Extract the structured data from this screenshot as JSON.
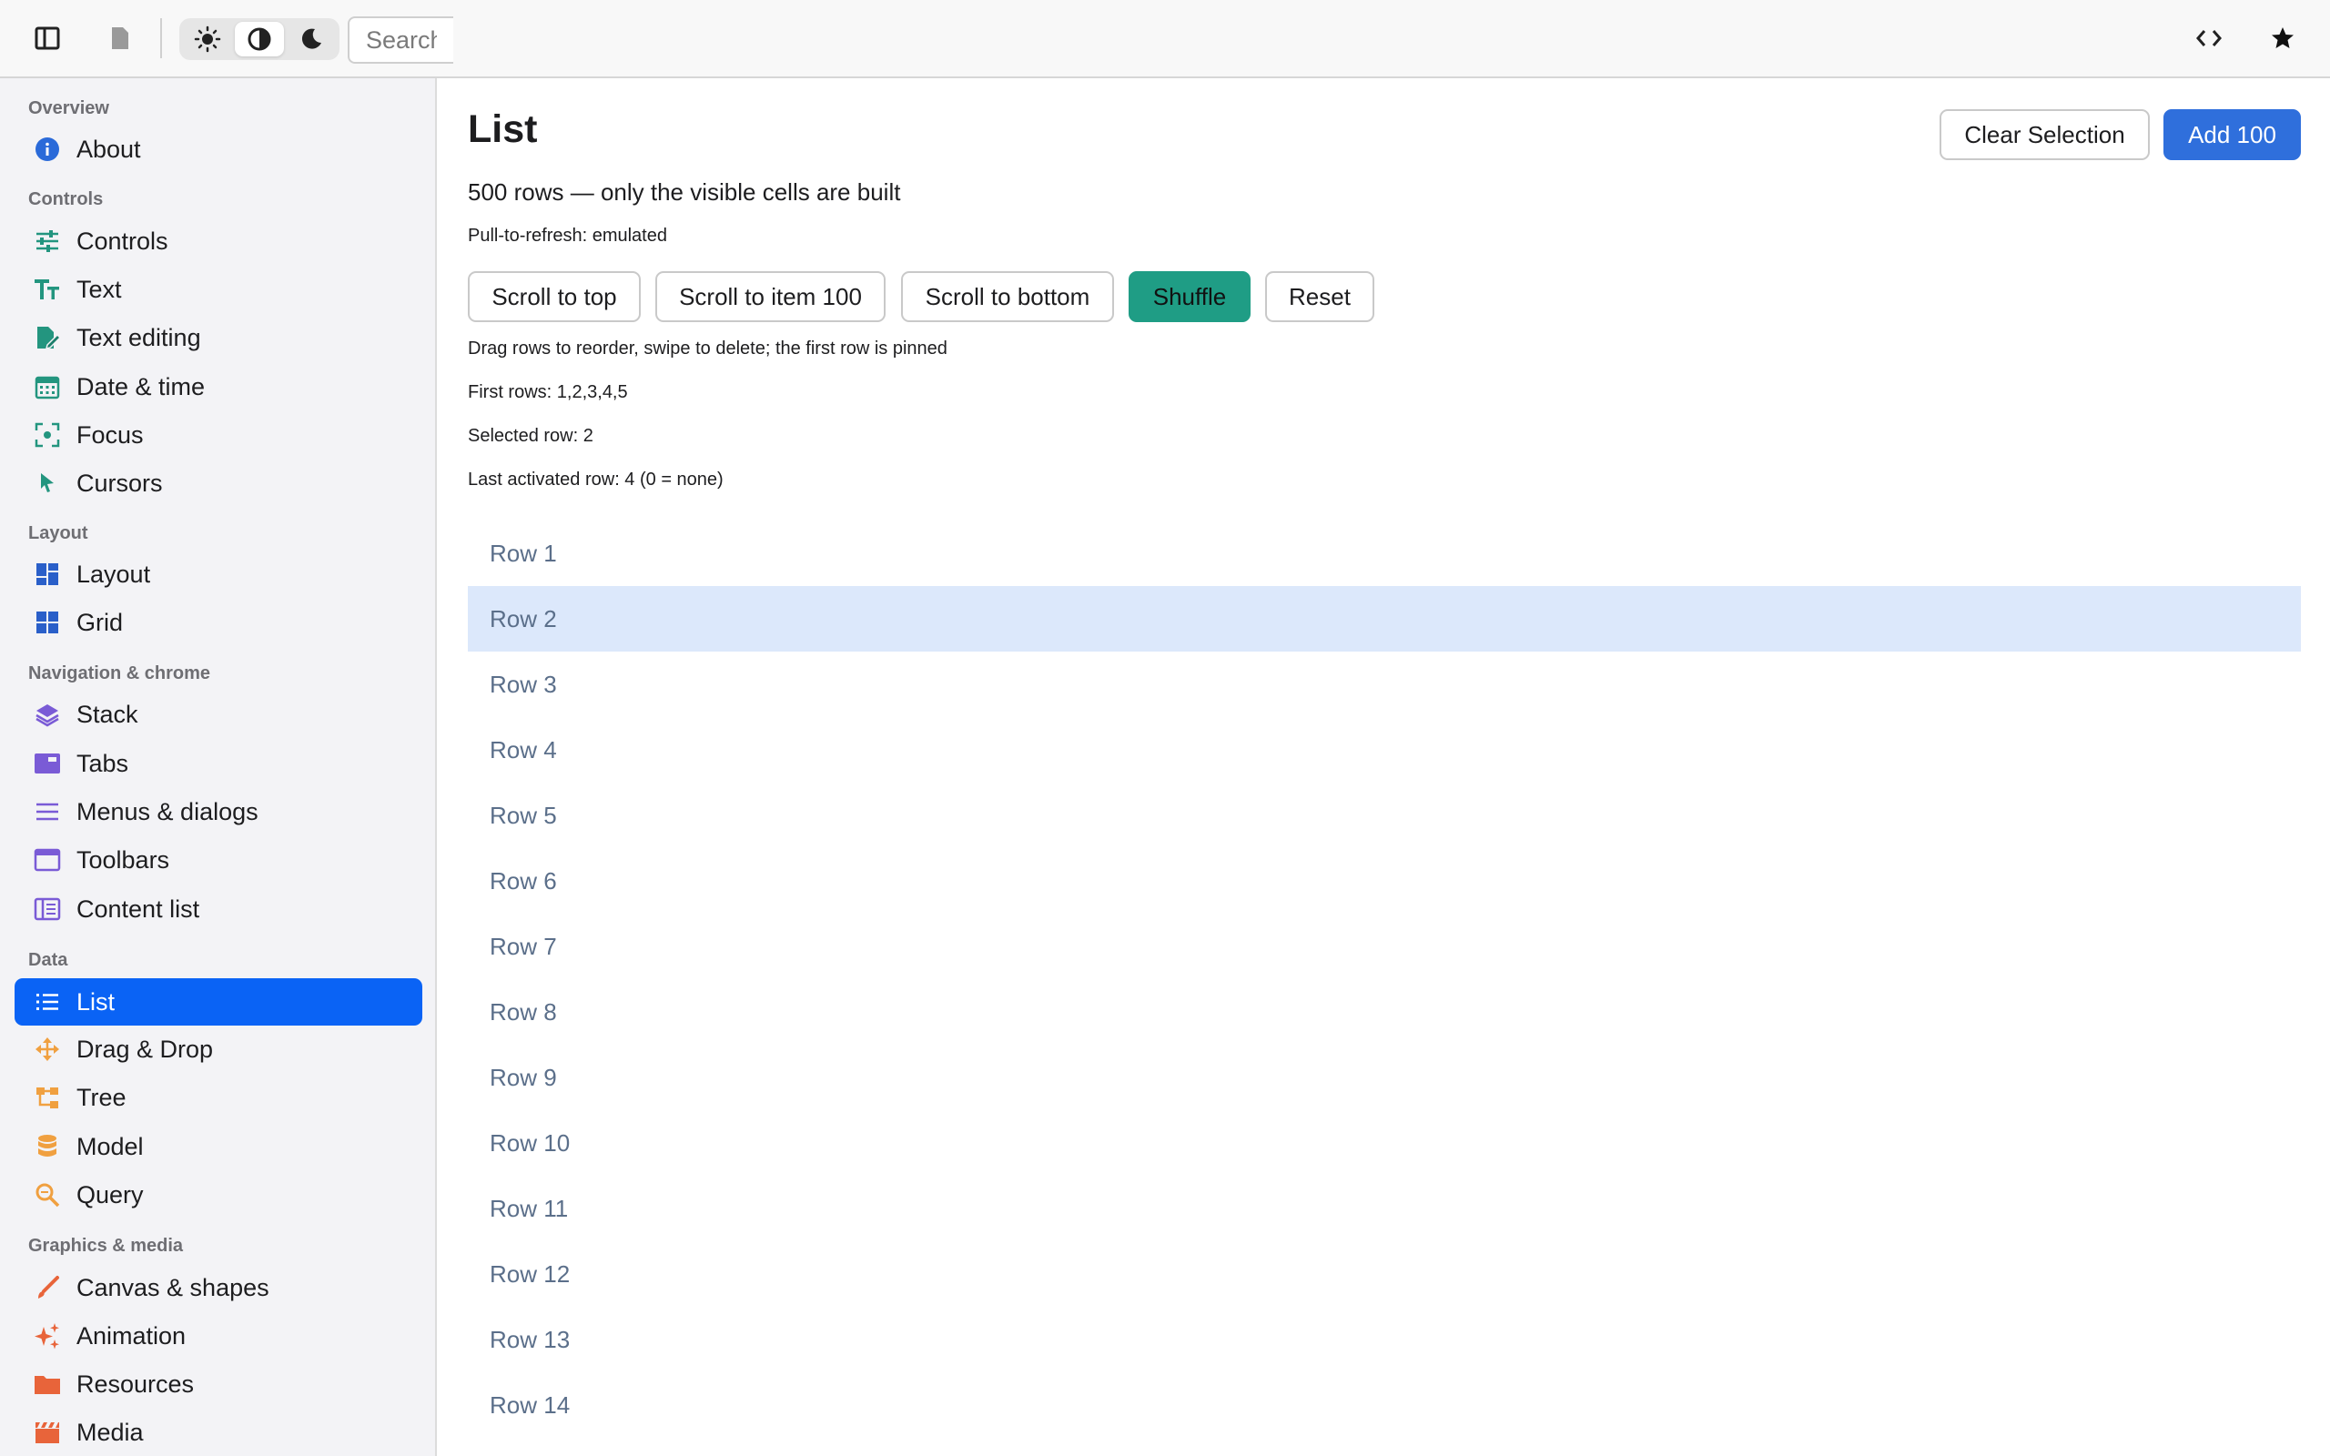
{
  "topbar": {
    "search_placeholder": "Search",
    "icons": [
      "sidebar-toggle-icon",
      "file-icon",
      "sun-icon",
      "contrast-icon",
      "moon-icon",
      "code-icon",
      "star-icon"
    ]
  },
  "sidebar": {
    "sections": [
      {
        "title": "Overview",
        "items": [
          {
            "label": "About",
            "icon": "info-icon"
          }
        ]
      },
      {
        "title": "Controls",
        "items": [
          {
            "label": "Controls",
            "icon": "sliders-icon"
          },
          {
            "label": "Text",
            "icon": "text-icon"
          },
          {
            "label": "Text editing",
            "icon": "edit-doc-icon"
          },
          {
            "label": "Date & time",
            "icon": "calendar-icon"
          },
          {
            "label": "Focus",
            "icon": "focus-icon"
          },
          {
            "label": "Cursors",
            "icon": "cursor-icon"
          }
        ]
      },
      {
        "title": "Layout",
        "items": [
          {
            "label": "Layout",
            "icon": "layout-icon"
          },
          {
            "label": "Grid",
            "icon": "grid-icon"
          }
        ]
      },
      {
        "title": "Navigation & chrome",
        "items": [
          {
            "label": "Stack",
            "icon": "layers-icon"
          },
          {
            "label": "Tabs",
            "icon": "tabs-icon"
          },
          {
            "label": "Menus & dialogs",
            "icon": "menu-icon"
          },
          {
            "label": "Toolbars",
            "icon": "window-icon"
          },
          {
            "label": "Content list",
            "icon": "content-list-icon"
          }
        ]
      },
      {
        "title": "Data",
        "items": [
          {
            "label": "List",
            "icon": "list-icon"
          },
          {
            "label": "Drag & Drop",
            "icon": "move-icon"
          },
          {
            "label": "Tree",
            "icon": "tree-icon"
          },
          {
            "label": "Model",
            "icon": "database-icon"
          },
          {
            "label": "Query",
            "icon": "search-icon"
          }
        ]
      },
      {
        "title": "Graphics & media",
        "items": [
          {
            "label": "Canvas & shapes",
            "icon": "brush-icon"
          },
          {
            "label": "Animation",
            "icon": "sparkle-icon"
          },
          {
            "label": "Resources",
            "icon": "folder-icon"
          },
          {
            "label": "Media",
            "icon": "clapper-icon"
          }
        ]
      }
    ],
    "active_item": "List"
  },
  "main": {
    "title": "List",
    "clear_selection_label": "Clear Selection",
    "add_label": "Add 100",
    "subtitle": "500 rows — only the visible cells are built",
    "pull_to_refresh": "Pull-to-refresh: emulated",
    "actions": {
      "scroll_top": "Scroll to top",
      "scroll_item": "Scroll to item 100",
      "scroll_bottom": "Scroll to bottom",
      "shuffle": "Shuffle",
      "reset": "Reset"
    },
    "hint": "Drag rows to reorder, swipe to delete; the first row is pinned",
    "first_rows": "First rows: 1,2,3,4,5",
    "selected_row": "Selected row: 2",
    "last_activated": "Last activated row: 4 (0 = none)",
    "rows": [
      "Row 1",
      "Row 2",
      "Row 3",
      "Row 4",
      "Row 5",
      "Row 6",
      "Row 7",
      "Row 8",
      "Row 9",
      "Row 10",
      "Row 11",
      "Row 12",
      "Row 13",
      "Row 14"
    ],
    "selected_index": 1
  },
  "colors": {
    "accent": "#0a63f5",
    "primary_button": "#2f6fdc",
    "shuffle_button": "#1f9d85",
    "selected_row": "#dce8fb",
    "teal_icons": "#23957f",
    "blue_icons": "#2a5fc9",
    "purple_icons": "#7a5bd6",
    "orange_icons": "#f0a040",
    "red_orange_icons": "#e8643a"
  }
}
